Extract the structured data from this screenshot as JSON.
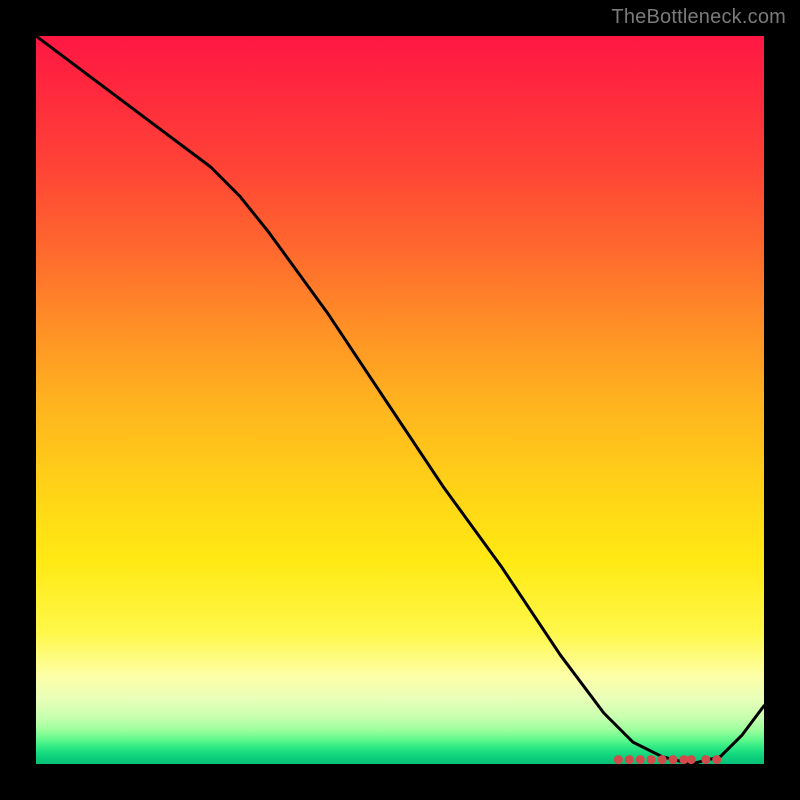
{
  "watermark": "TheBottleneck.com",
  "colors": {
    "frame": "#000000",
    "curve": "#000000",
    "dots": "#d24a4a",
    "gradient_top": "#ff1744",
    "gradient_mid": "#ffe913",
    "gradient_bottom": "#06c076"
  },
  "chart_data": {
    "type": "line",
    "title": "",
    "xlabel": "",
    "ylabel": "",
    "xlim": [
      0,
      100
    ],
    "ylim": [
      0,
      100
    ],
    "grid": false,
    "series": [
      {
        "name": "curve",
        "x": [
          0,
          8,
          16,
          24,
          28,
          32,
          40,
          48,
          56,
          64,
          72,
          78,
          82,
          86,
          90,
          94,
          97,
          100
        ],
        "values": [
          100,
          94,
          88,
          82,
          78,
          73,
          62,
          50,
          38,
          27,
          15,
          7,
          3,
          1,
          0,
          1,
          4,
          8
        ]
      }
    ],
    "annotations": {
      "bottom_dots_x": [
        80,
        81.5,
        83,
        84.5,
        86,
        87.5,
        89,
        90,
        92,
        93.5
      ],
      "bottom_dots_y": 0.6
    }
  }
}
